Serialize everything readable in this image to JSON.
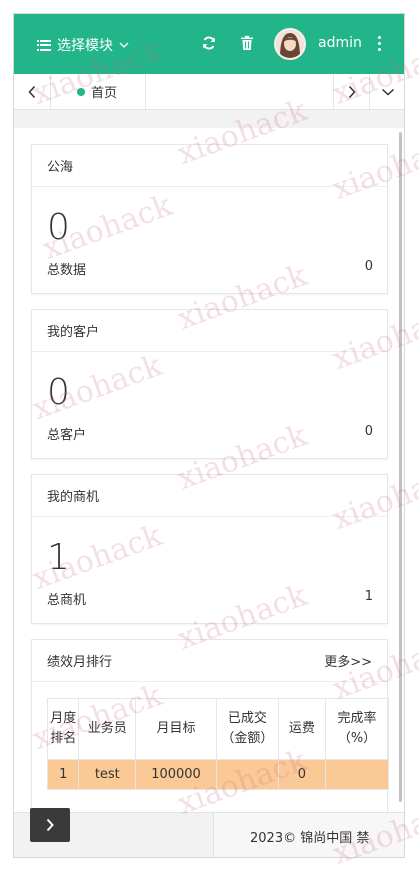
{
  "header": {
    "menu_label": "选择模块",
    "username": "admin",
    "icons": [
      "list-icon",
      "refresh-icon",
      "trash-icon",
      "more-icon"
    ]
  },
  "tabs": {
    "items": [
      {
        "label": "首页",
        "active": true
      }
    ]
  },
  "cards": {
    "public_sea": {
      "title": "公海",
      "big_value": "0",
      "sub_label": "总数据",
      "sub_value": "0"
    },
    "my_customers": {
      "title": "我的客户",
      "big_value": "0",
      "sub_label": "总客户",
      "sub_value": "0"
    },
    "my_opportunities": {
      "title": "我的商机",
      "big_value": "1",
      "sub_label": "总商机",
      "sub_value": "1"
    }
  },
  "performance": {
    "title": "绩效月排行",
    "more_link": "更多>>",
    "columns": [
      "月度排名",
      "业务员",
      "月目标",
      "已成交（金额）",
      "运费",
      "完成率（%）"
    ],
    "rows": [
      [
        "1",
        "test",
        "100000",
        "",
        "0",
        ""
      ]
    ]
  },
  "footer": {
    "copyright": "2023© 锦尚中国 禁"
  },
  "watermark": "xiaohack",
  "colors": {
    "brand": "#22b589",
    "row_highlight": "#fbc995"
  }
}
